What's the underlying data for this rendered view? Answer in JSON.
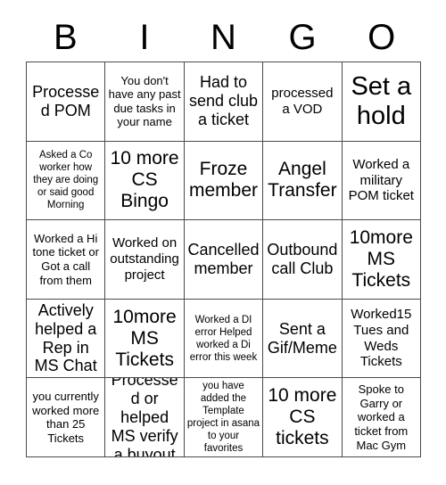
{
  "card": {
    "title": "BINGO",
    "header_letters": [
      "B",
      "I",
      "N",
      "G",
      "O"
    ],
    "grid_size": "5x5",
    "colors": {
      "background": "#ffffff",
      "text": "#000000",
      "border": "#4a4a4a"
    },
    "rows": [
      [
        {
          "text": "Processed POM",
          "size": "lg"
        },
        {
          "text": "You don't have any past due tasks in your name",
          "size": "sm"
        },
        {
          "text": "Had to send club a ticket",
          "size": "lg"
        },
        {
          "text": "processed a VOD",
          "size": "md"
        },
        {
          "text": "Set a hold",
          "size": "xxl"
        }
      ],
      [
        {
          "text": "Asked a Co worker how they are doing or said good Morning",
          "size": "xs"
        },
        {
          "text": "10 more CS Bingo",
          "size": "xl"
        },
        {
          "text": "Froze member",
          "size": "xl"
        },
        {
          "text": "Angel Transfer",
          "size": "xl"
        },
        {
          "text": "Worked a military POM ticket",
          "size": "md"
        }
      ],
      [
        {
          "text": "Worked a Hi tone ticket or Got a call from them",
          "size": "sm"
        },
        {
          "text": "Worked on outstanding project",
          "size": "md"
        },
        {
          "text": "Cancelled member",
          "size": "lg"
        },
        {
          "text": "Outbound call Club",
          "size": "lg"
        },
        {
          "text": "10more MS Tickets",
          "size": "xl"
        }
      ],
      [
        {
          "text": "Actively helped a Rep in MS Chat",
          "size": "lg"
        },
        {
          "text": "10more MS Tickets",
          "size": "xl"
        },
        {
          "text": "Worked a DI error Helped worked a Di error this week",
          "size": "xs"
        },
        {
          "text": "Sent a Gif/Meme",
          "size": "lg"
        },
        {
          "text": "Worked15 Tues and Weds Tickets",
          "size": "md"
        }
      ],
      [
        {
          "text": "you currently worked more than 25 Tickets",
          "size": "sm"
        },
        {
          "text": "Processed or helped MS verify a buyout",
          "size": "lg"
        },
        {
          "text": "you have added the Template project in asana to your favorites",
          "size": "xs"
        },
        {
          "text": "10 more CS tickets",
          "size": "xl"
        },
        {
          "text": "Spoke to Garry or worked a ticket from Mac Gym",
          "size": "sm"
        }
      ]
    ]
  }
}
